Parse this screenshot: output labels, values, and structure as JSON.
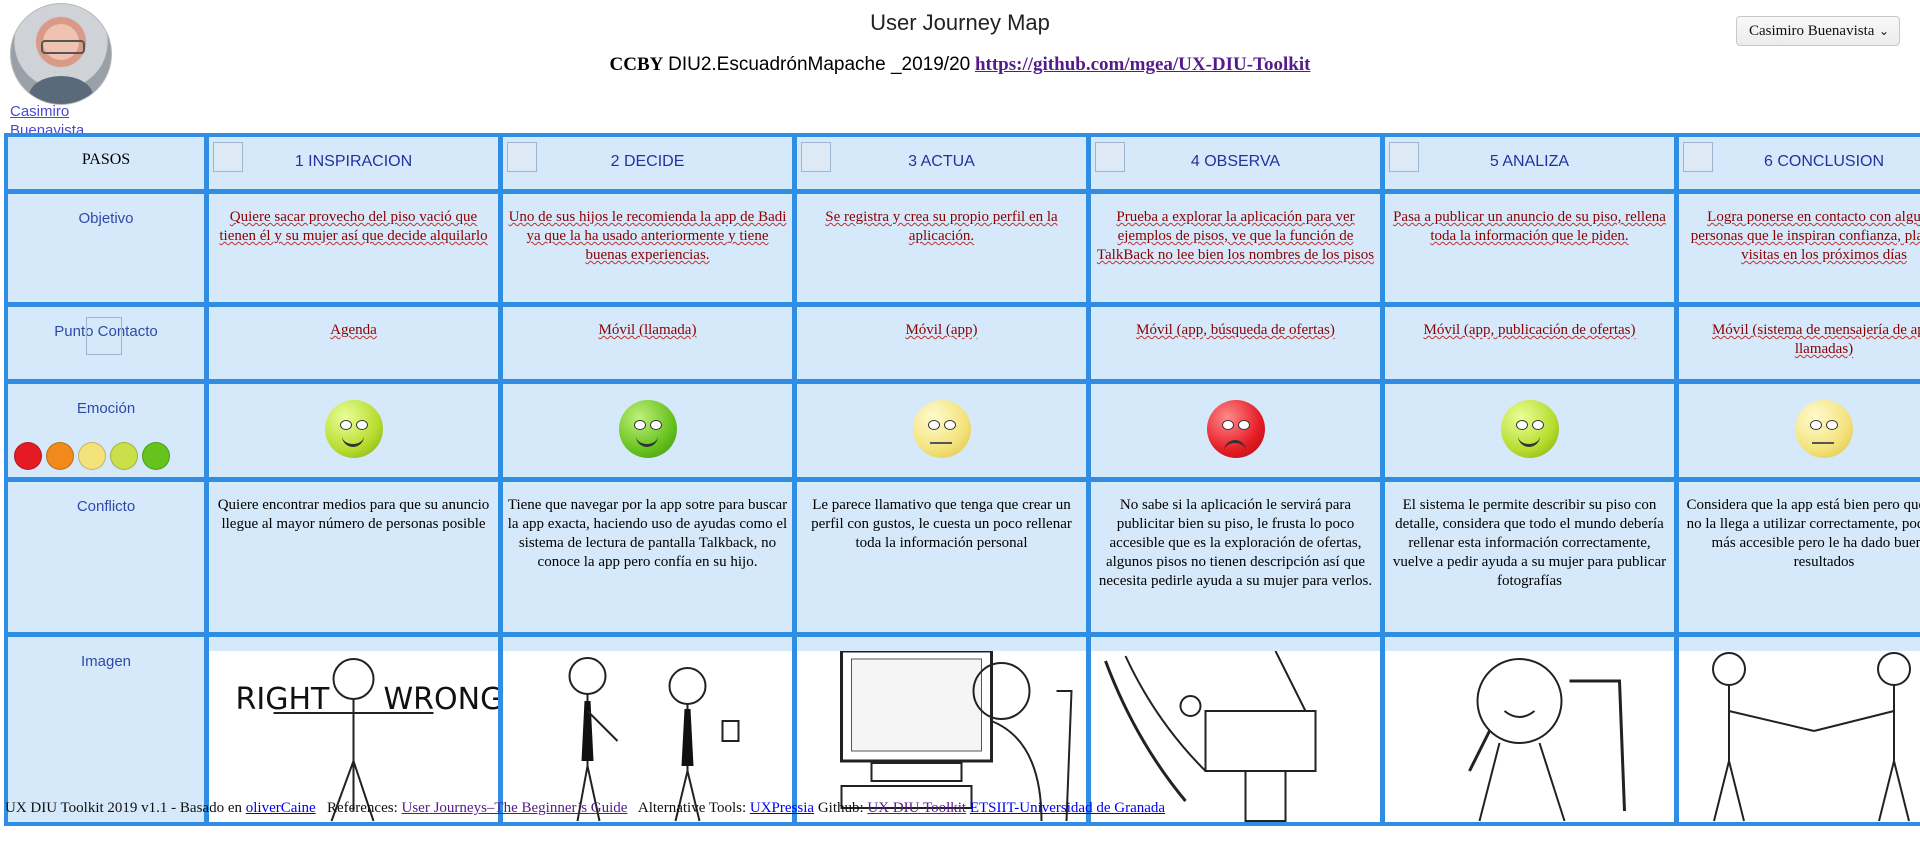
{
  "header": {
    "title": "User Journey Map",
    "license": "CCBY",
    "team": "DIU2.EscuadrónMapache _2019/20",
    "repo_link": "https://github.com/mgea/UX-DIU-Toolkit",
    "user_name": "Casimiro Buenavista",
    "user_menu_label": "Casimiro Buenavista"
  },
  "table": {
    "corner_label": "PASOS",
    "row_labels": {
      "objetivo": "Objetivo",
      "contacto": "Punto Contacto",
      "emocion": "Emoción",
      "conflicto": "Conflicto",
      "imagen": "Imagen"
    },
    "steps": [
      {
        "title": "1 INSPIRACION",
        "objetivo": "Quiere sacar provecho del piso vació que tienen él y su mujer así que decide alquilarlo",
        "contacto": "Agenda",
        "emotion": "lime",
        "conflicto": "Quiere encontrar medios para que su anuncio llegue al mayor número de personas posible",
        "image": "right-wrong-stickman"
      },
      {
        "title": "2 DECIDE",
        "objetivo": "Uno de sus hijos le recomienda la app de Badi ya que la ha usado anteriormente y tiene buenas experiencias.",
        "contacto": "Móvil (llamada)",
        "emotion": "green",
        "conflicto": "Tiene que navegar por la app sotre para buscar la app exacta, haciendo uso de ayudas como el sistema de lectura de pantalla Talkback, no conoce la app pero confía en su hijo.",
        "image": "two-businessmen"
      },
      {
        "title": "3 ACTUA",
        "objetivo": "Se registra y crea su propio perfil en la aplicación.",
        "contacto": "Móvil (app)",
        "emotion": "yellow",
        "conflicto": "Le parece llamativo que tenga que crear un perfil con gustos, le cuesta un poco rellenar toda la información personal",
        "image": "man-at-computer"
      },
      {
        "title": "4 OBSERVA",
        "objetivo": "Prueba a explorar la aplicación para ver ejemplos de pisos, ve que la función de TalkBack no lee bien los nombres de los pisos",
        "contacto": "Móvil (app, búsqueda de ofertas)",
        "emotion": "red",
        "conflicto": "No sabe si la aplicación le servirá para publicitar bien su piso, le frusta lo poco accesible que es la exploración de ofertas, algunos pisos no tienen descripción así que necesita pedirle ayuda a su mujer para verlos.",
        "image": "frustrated-at-computer"
      },
      {
        "title": "5 ANALIZA",
        "objetivo": "Pasa a publicar un anuncio de su piso, rellena toda la información que le piden.",
        "contacto": "Móvil (app, publicación de ofertas)",
        "emotion": "lime",
        "conflicto": "El sistema le permite describir su piso con detalle, considera que todo el mundo debería rellenar esta información correctamente, vuelve a pedir ayuda a su mujer para publicar fotografías",
        "image": "thinking-man"
      },
      {
        "title": "6 CONCLUSION",
        "objetivo": "Logra ponerse en contacto con algunas personas que le inspiran confianza, planifica visitas en los próximos días",
        "contacto": "Móvil (sistema de mensajería de app, llamadas)",
        "emotion": "yellow",
        "conflicto": "Considera que la app está bien pero que gente no la llega a utilizar correctamente, podría ser más accesible pero le ha dado buenos resultados",
        "image": "handshake"
      }
    ],
    "sketch_texts": {
      "right": "RIGHT",
      "wrong": "WRONG"
    }
  },
  "footer": {
    "text1": "UX DIU Toolkit 2019 v1.1 - Basado en",
    "link1": "oliverCaine",
    "text2": "References:",
    "link2": "User Journeys–The Beginner’s Guide",
    "text3": "Alternative Tools:",
    "link3": "UXPressia",
    "text4": "Github:",
    "link4": "UX DIU Toolkit",
    "link5": "ETSIIT-Universidad de Granada"
  }
}
